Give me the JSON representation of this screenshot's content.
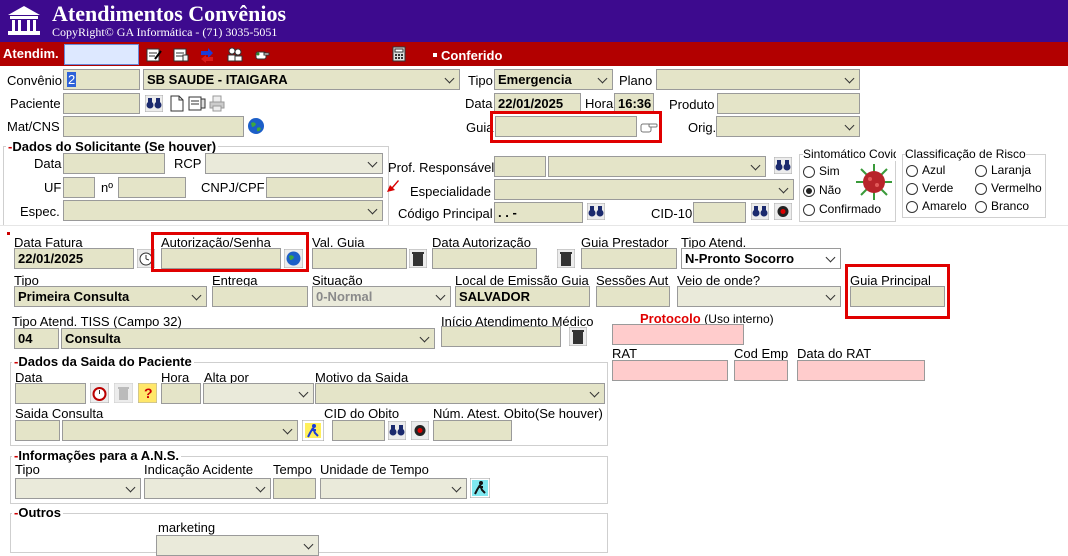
{
  "header": {
    "title": "Atendimentos Convênios",
    "copyright": "CopyRight© GA Informática - (71) 3035-5051",
    "logo_icon": "building-icon"
  },
  "toolbar": {
    "atendim_label": "Atendim.",
    "conferido_label": "Conferido",
    "icons": [
      "form-edit-icon",
      "form-open-icon",
      "transfer-icon",
      "users-icon",
      "hand-point-icon",
      "calculator-icon"
    ]
  },
  "top": {
    "convenio_label": "Convênio",
    "convenio_code": "2",
    "convenio_name": "SB SAUDE - ITAIGARA",
    "tipo_label": "Tipo",
    "tipo_value": "Emergencia",
    "plano_label": "Plano",
    "plano_value": "",
    "paciente_label": "Paciente",
    "data_label": "Data",
    "data_value": "22/01/2025",
    "hora_label": "Hora",
    "hora_value": "16:36",
    "produto_label": "Produto",
    "matcns_label": "Mat/CNS",
    "guia_label": "Guia",
    "orig_label": "Orig."
  },
  "solicitante": {
    "title": "Dados do Solicitante (Se houver)",
    "data_label": "Data",
    "rcp_label": "RCP",
    "uf_label": "UF",
    "numero_label": "nº",
    "cnpj_label": "CNPJ/CPF",
    "espec_label": "Espec.",
    "prof_label": "Prof. Responsável",
    "especialidade_label": "Especialidade",
    "codigo_label": "Código Principal",
    "codigo_value": ". .  -",
    "cid_label": "CID-10"
  },
  "sintomatico": {
    "title": "Sintomático Covid",
    "options": [
      "Sim",
      "Não",
      "Confirmado"
    ],
    "selected": "Não"
  },
  "risco": {
    "title": "Classificação de Risco",
    "options": [
      "Azul",
      "Laranja",
      "Verde",
      "Vermelho",
      "Amarelo",
      "Branco"
    ]
  },
  "fatura": {
    "data_fatura_label": "Data Fatura",
    "data_fatura_value": "22/01/2025",
    "autorizacao_label": "Autorização/Senha",
    "val_guia_label": "Val. Guia",
    "data_aut_label": "Data Autorização",
    "guia_prest_label": "Guia Prestador",
    "tipo_atend_label": "Tipo Atend.",
    "tipo_atend_value": "N-Pronto Socorro",
    "tipo_label": "Tipo",
    "tipo_value": "Primeira Consulta",
    "entrega_label": "Entrega",
    "situacao_label": "Situação",
    "situacao_value": "0-Normal",
    "local_label": "Local de Emissão Guia",
    "local_value": "SALVADOR",
    "sessoes_label": "Sessões Aut",
    "veio_label": "Veio de onde?",
    "guia_principal_label": "Guia Principal",
    "tiss_label": "Tipo Atend. TISS (Campo 32)",
    "tiss_code": "04",
    "tiss_value": "Consulta",
    "inicio_label": "Início Atendimento Médico",
    "protocolo_label": "Protocolo",
    "protocolo_note": "(Uso interno)",
    "rat_label": "RAT",
    "cod_emp_label": "Cod Emp",
    "data_rat_label": "Data do RAT"
  },
  "saida": {
    "title": "Dados da Saida do Paciente",
    "data_label": "Data",
    "hora_label": "Hora",
    "alta_label": "Alta por",
    "motivo_label": "Motivo da Saida",
    "saida_consulta_label": "Saida Consulta",
    "cid_obito_label": "CID do Obito",
    "num_atest_label": "Núm. Atest. Obito(Se houver)"
  },
  "ans": {
    "title": "Informações para a A.N.S.",
    "tipo_label": "Tipo",
    "indicacao_label": "Indicação Acidente",
    "tempo_label": "Tempo",
    "unidade_label": "Unidade de Tempo"
  },
  "outros": {
    "title": "Outros",
    "marketing_label": "marketing"
  },
  "colors": {
    "header": "#3d0a8e",
    "toolbar": "#b20000",
    "field": "#e4e4c8",
    "pink": "#ffcccc",
    "highlight": "#e00000"
  }
}
